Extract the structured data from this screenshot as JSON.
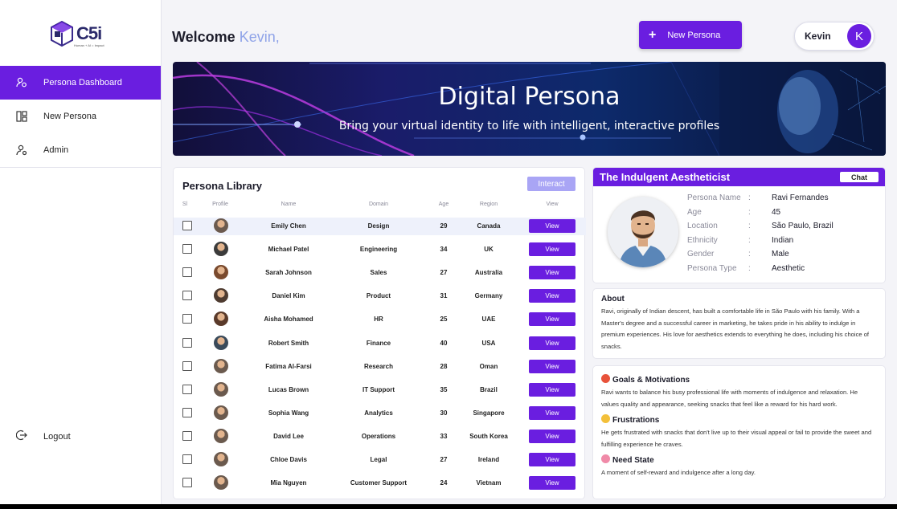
{
  "app": {
    "logo_text": "C5i",
    "logo_tagline": "Human + AI = Impact"
  },
  "sidebar": {
    "items": [
      {
        "label": "Persona Dashboard",
        "icon": "users-icon",
        "active": true
      },
      {
        "label": "New Persona",
        "icon": "layout-icon",
        "active": false
      },
      {
        "label": "Admin",
        "icon": "admin-icon",
        "active": false
      }
    ],
    "logout_label": "Logout"
  },
  "header": {
    "welcome_label": "Welcome",
    "user_name": "Kevin,",
    "new_persona_label": "New Persona",
    "user_chip_name": "Kevin",
    "avatar_initial": "K"
  },
  "banner": {
    "title": "Digital Persona",
    "subtitle": "Bring your virtual identity to life with intelligent, interactive profiles"
  },
  "library": {
    "title": "Persona Library",
    "interact_label": "Interact",
    "columns": [
      "Sl",
      "Profile",
      "Name",
      "Domain",
      "Age",
      "Region",
      "View"
    ],
    "view_label": "View",
    "rows": [
      {
        "name": "Emily Chen",
        "domain": "Design",
        "age": "29",
        "region": "Canada"
      },
      {
        "name": "Michael Patel",
        "domain": "Engineering",
        "age": "34",
        "region": "UK"
      },
      {
        "name": "Sarah Johnson",
        "domain": "Sales",
        "age": "27",
        "region": "Australia"
      },
      {
        "name": "Daniel Kim",
        "domain": "Product",
        "age": "31",
        "region": "Germany"
      },
      {
        "name": "Aisha Mohamed",
        "domain": "HR",
        "age": "25",
        "region": "UAE"
      },
      {
        "name": "Robert Smith",
        "domain": "Finance",
        "age": "40",
        "region": "USA"
      },
      {
        "name": "Fatima Al-Farsi",
        "domain": "Research",
        "age": "28",
        "region": "Oman"
      },
      {
        "name": "Lucas Brown",
        "domain": "IT Support",
        "age": "35",
        "region": "Brazil"
      },
      {
        "name": "Sophia Wang",
        "domain": "Analytics",
        "age": "30",
        "region": "Singapore"
      },
      {
        "name": "David Lee",
        "domain": "Operations",
        "age": "33",
        "region": "South Korea"
      },
      {
        "name": "Chloe Davis",
        "domain": "Legal",
        "age": "27",
        "region": "Ireland"
      },
      {
        "name": "Mia Nguyen",
        "domain": "Customer Support",
        "age": "24",
        "region": "Vietnam"
      }
    ]
  },
  "detail": {
    "title": "The Indulgent Aestheticist",
    "chat_label": "Chat",
    "fields": [
      {
        "key": "Persona Name",
        "value": "Ravi Fernandes"
      },
      {
        "key": "Age",
        "value": "45"
      },
      {
        "key": "Location",
        "value": "São Paulo, Brazil"
      },
      {
        "key": "Ethnicity",
        "value": "Indian"
      },
      {
        "key": "Gender",
        "value": "Male"
      },
      {
        "key": "Persona Type",
        "value": "Aesthetic"
      }
    ],
    "separator": ":"
  },
  "about": {
    "title": "About",
    "text": "Ravi, originally of Indian descent, has built a comfortable life in São Paulo with his family. With a Master's degree and a successful career in marketing, he takes pride in his ability to indulge in premium experiences. His love for aesthetics extends to everything he does, including his choice of snacks."
  },
  "sections": {
    "goals_title": "Goals & Motivations",
    "goals_text": "Ravi wants to balance his busy professional life with moments of indulgence and relaxation. He values quality and appearance, seeking snacks that feel like a reward for his hard work.",
    "frustrations_title": "Frustrations",
    "frustrations_text": "He gets frustrated with snacks that don't live up to their visual appeal or fail to provide the sweet and fulfilling experience he craves.",
    "need_title": "Need State",
    "need_text": "A moment of self-reward and indulgence after a long day."
  },
  "colors": {
    "accent": "#6a1ee0",
    "interact": "#a9a5f5",
    "banner_dark": "#120f3a"
  }
}
